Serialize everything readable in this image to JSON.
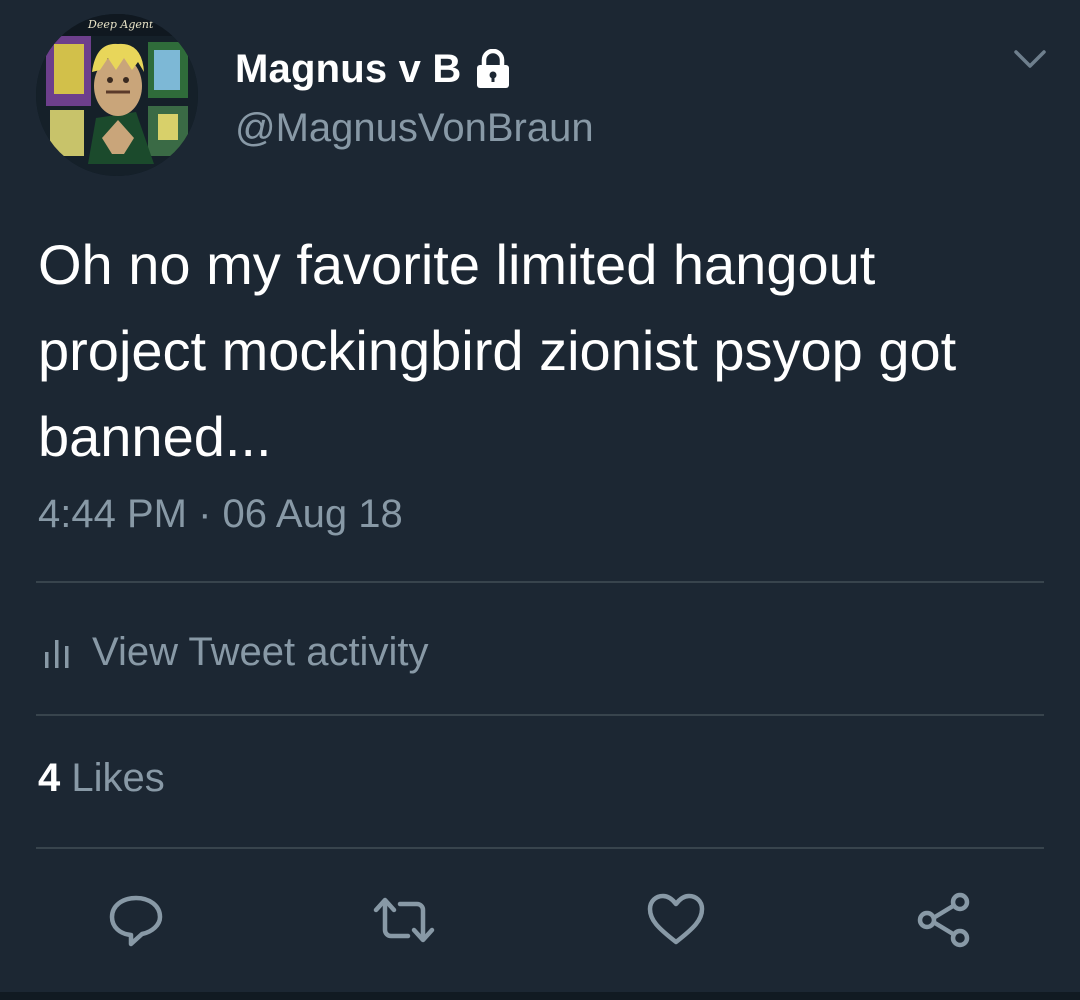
{
  "user": {
    "display_name": "Magnus v B",
    "handle": "@MagnusVonBraun",
    "avatar_caption": "Deep Agent"
  },
  "tweet": {
    "text": "Oh no my favorite limited hangout project mockingbird zionist psyop got banned...",
    "timestamp": "4:44 PM · 06 Aug 18"
  },
  "activity": {
    "label": "View Tweet activity"
  },
  "likes": {
    "count": "4",
    "label": "Likes"
  },
  "icons": {
    "lock": "lock-icon",
    "caret": "chevron-down-icon",
    "activity": "bar-chart-icon",
    "reply": "reply-icon",
    "retweet": "retweet-icon",
    "like": "heart-icon",
    "share": "share-icon"
  },
  "colors": {
    "background": "#1c2733",
    "text_primary": "#ffffff",
    "text_secondary": "#8899a6",
    "divider": "#38444d"
  }
}
